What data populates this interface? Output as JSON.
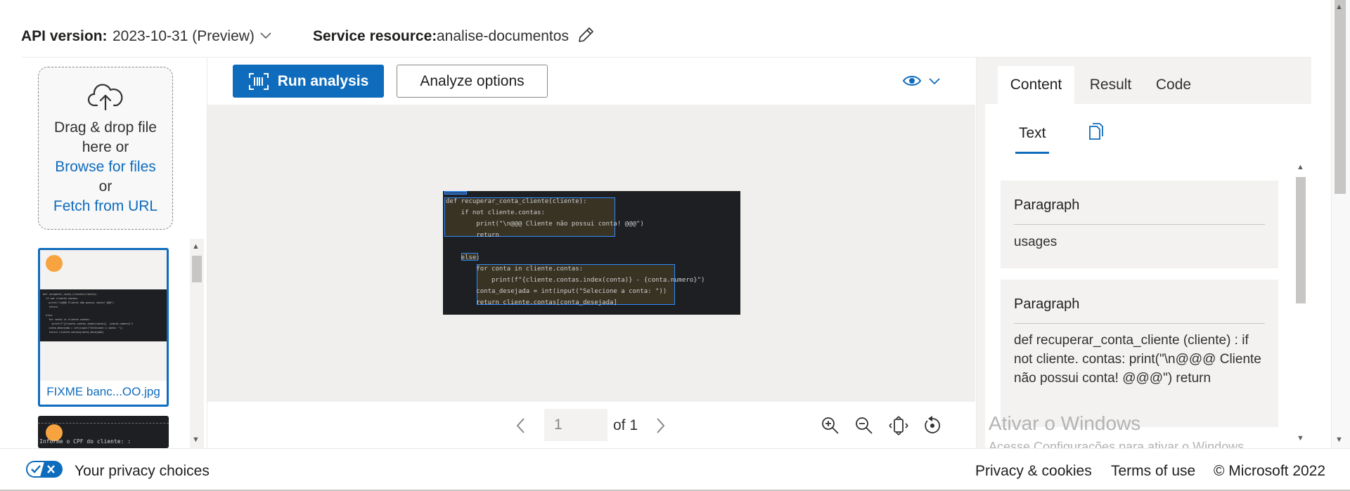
{
  "header": {
    "api_label": "API version:",
    "api_value": "2023-10-31 (Preview)",
    "service_label": "Service resource:",
    "service_value": "analise-documentos"
  },
  "upload": {
    "line1": "Drag & drop file",
    "line2": "here or",
    "browse": "Browse for files",
    "or": "or",
    "fetch": "Fetch from URL"
  },
  "files": [
    {
      "name": "FIXME banc...OO.jpg",
      "selected": true
    },
    {
      "name": "",
      "preview_text": "Informe o CPF do cliente: :",
      "selected": false
    }
  ],
  "toolbar": {
    "run_label": "Run analysis",
    "options_label": "Analyze options"
  },
  "document": {
    "lines": [
      "def recuperar_conta_cliente(cliente):",
      "    if not cliente.contas:",
      "        print(\"\\n@@@ Cliente não possui conta! @@@\")",
      "        return",
      "",
      "    else:",
      "        for conta in cliente.contas:",
      "            print(f\"{cliente.contas.index(conta)} - {conta.numero}\")",
      "        conta_desejada = int(input(\"Selecione a conta: \"))",
      "        return cliente.contas[conta_desejada]"
    ]
  },
  "pager": {
    "page": "1",
    "of_label": "of 1"
  },
  "right_panel": {
    "tabs": [
      "Content",
      "Result",
      "Code"
    ],
    "active_tab": "Content",
    "subtab": "Text",
    "paragraphs": [
      {
        "title": "Paragraph",
        "text": "usages"
      },
      {
        "title": "Paragraph",
        "text": "def recuperar_conta_cliente (cliente) : if not cliente. contas: print(\"\\n@@@ Cliente não possui conta! @@@\") return"
      }
    ],
    "watermark_title": "Ativar o Windows",
    "watermark_sub": "Acesse Configurações para ativar o Windows."
  },
  "footer": {
    "privacy": "Your privacy choices",
    "privacy_cookies": "Privacy & cookies",
    "terms": "Terms of use",
    "copyright": "© Microsoft 2022"
  },
  "colors": {
    "accent": "#0f6cbd",
    "dot": "#f7a440",
    "doc_bg": "#1e1f22"
  }
}
